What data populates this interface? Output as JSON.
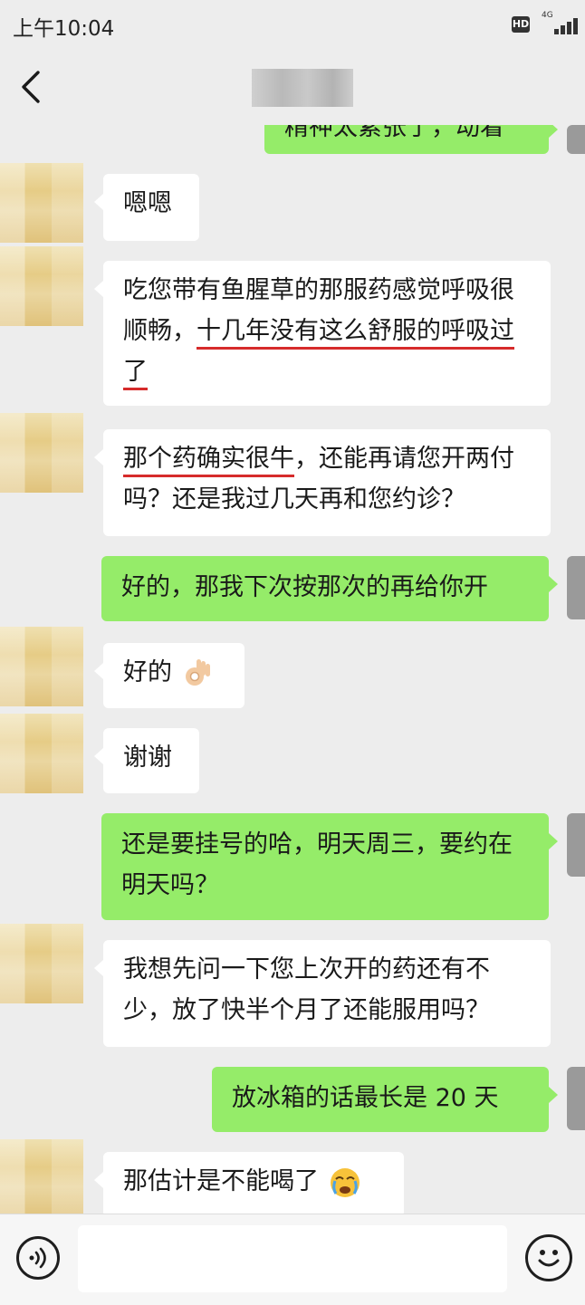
{
  "status_bar": {
    "time": "上午10:04",
    "hd_label": "HD",
    "network": "4G"
  },
  "header": {
    "back_icon": "chevron-left-icon",
    "contact_name": ""
  },
  "messages": [
    {
      "from": "self",
      "text": "精神太紧张了，动着"
    },
    {
      "from": "other",
      "text": "嗯嗯"
    },
    {
      "from": "other",
      "text_plain": "吃您带有鱼腥草的那服药感觉呼吸很顺畅，",
      "text_underlined": "十几年没有这么舒服的呼吸过了"
    },
    {
      "from": "other",
      "text_underlined": "那个药确实很牛",
      "text_plain": "，还能再请您开两付吗？还是我过几天再和您约诊？"
    },
    {
      "from": "self",
      "text": "好的，那我下次按那次的再给你开"
    },
    {
      "from": "other",
      "text": "好的",
      "emoji": "ok-hand-icon"
    },
    {
      "from": "other",
      "text": "谢谢"
    },
    {
      "from": "self",
      "text": "还是要挂号的哈，明天周三，要约在明天吗？"
    },
    {
      "from": "other",
      "text": "我想先问一下您上次开的药还有不少，放了快半个月了还能服用吗？"
    },
    {
      "from": "self",
      "text": "放冰箱的话最长是 20 天"
    },
    {
      "from": "other",
      "text": "那估计是不能喝了",
      "emoji": "crying-face-icon"
    }
  ],
  "input_bar": {
    "voice_icon": "voice-icon",
    "emoji_icon": "smiley-icon",
    "input_value": ""
  },
  "colors": {
    "background": "#ededed",
    "self_bubble": "#95ec69",
    "other_bubble": "#ffffff",
    "underline": "#d62b2b"
  }
}
